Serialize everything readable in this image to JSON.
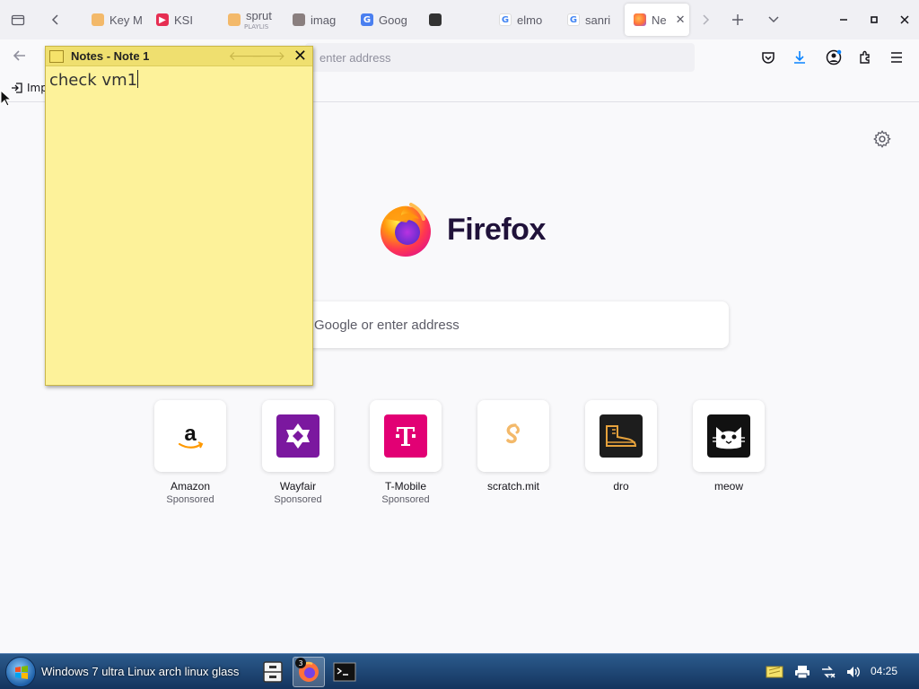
{
  "browser": {
    "tabs": [
      {
        "title": "Key M",
        "favicon": "bookmark-icon",
        "color": "#f3b96a"
      },
      {
        "title": "KSI",
        "favicon": "youtube-icon",
        "color": "#e62e52"
      },
      {
        "title": "sprut",
        "subtitle": "PLAYLIS",
        "favicon": "bookmark-icon",
        "color": "#f3b96a"
      },
      {
        "title": "imag",
        "favicon": "image-icon",
        "color": "#8a7f7f"
      },
      {
        "title": "Goog",
        "favicon": "google-translate-icon",
        "color": "#4a7ff0"
      },
      {
        "title": "",
        "favicon": "cat-icon",
        "color": "#333333"
      },
      {
        "title": "elmo",
        "favicon": "google-icon",
        "color": "#4285f4"
      },
      {
        "title": "sanri",
        "favicon": "google-icon",
        "color": "#4285f4"
      },
      {
        "title": "Ne",
        "favicon": "firefox-icon",
        "color": "#ff7139",
        "active": true
      }
    ],
    "url_placeholder": "enter address",
    "bookmark_label": "Imp"
  },
  "newtab": {
    "brand_name": "Firefox",
    "search_placeholder": "Google or enter address",
    "top_sites": [
      {
        "name": "Amazon",
        "sponsored": "Sponsored",
        "icon": "amazon-icon",
        "color": "#ffffff"
      },
      {
        "name": "Wayfair",
        "sponsored": "Sponsored",
        "icon": "wayfair-icon",
        "color": "#7b189f"
      },
      {
        "name": "T-Mobile",
        "sponsored": "Sponsored",
        "icon": "tmobile-icon",
        "color": "#e20074"
      },
      {
        "name": "scratch.mit",
        "sponsored": "",
        "icon": "scratch-icon",
        "color": "#ffffff"
      },
      {
        "name": "dro",
        "sponsored": "",
        "icon": "boot-icon",
        "color": "#1d1d1d"
      },
      {
        "name": "meow",
        "sponsored": "",
        "icon": "cat-face-icon",
        "color": "#111111"
      }
    ]
  },
  "note": {
    "title": "Notes - Note 1",
    "content": "check vm1"
  },
  "taskbar": {
    "start_text": "Windows 7 ultra Linux arch linux glass",
    "firefox_badge": "3",
    "clock": "04:25"
  }
}
